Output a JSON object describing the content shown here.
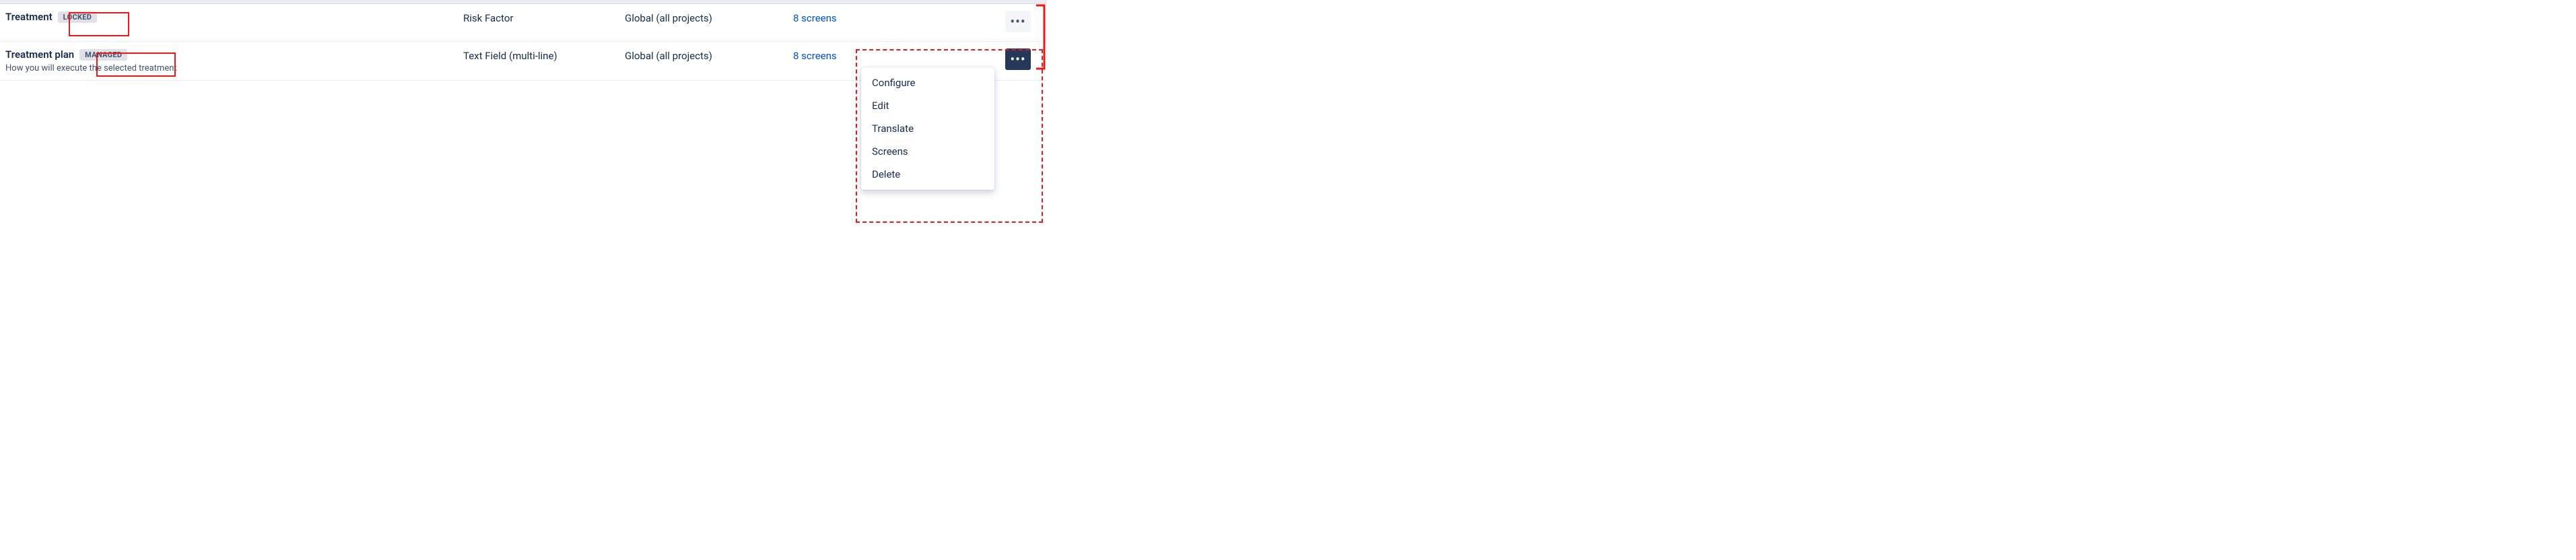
{
  "rows": [
    {
      "name": "Treatment",
      "badge": "LOCKED",
      "description": "",
      "type": "Risk Factor",
      "scope": "Global (all projects)",
      "screens": "8 screens"
    },
    {
      "name": "Treatment plan",
      "badge": "MANAGED",
      "description": "How you will execute the selected treatment",
      "type": "Text Field (multi-line)",
      "scope": "Global (all projects)",
      "screens": "8 screens"
    }
  ],
  "menu": {
    "items": [
      "Configure",
      "Edit",
      "Translate",
      "Screens",
      "Delete"
    ]
  }
}
